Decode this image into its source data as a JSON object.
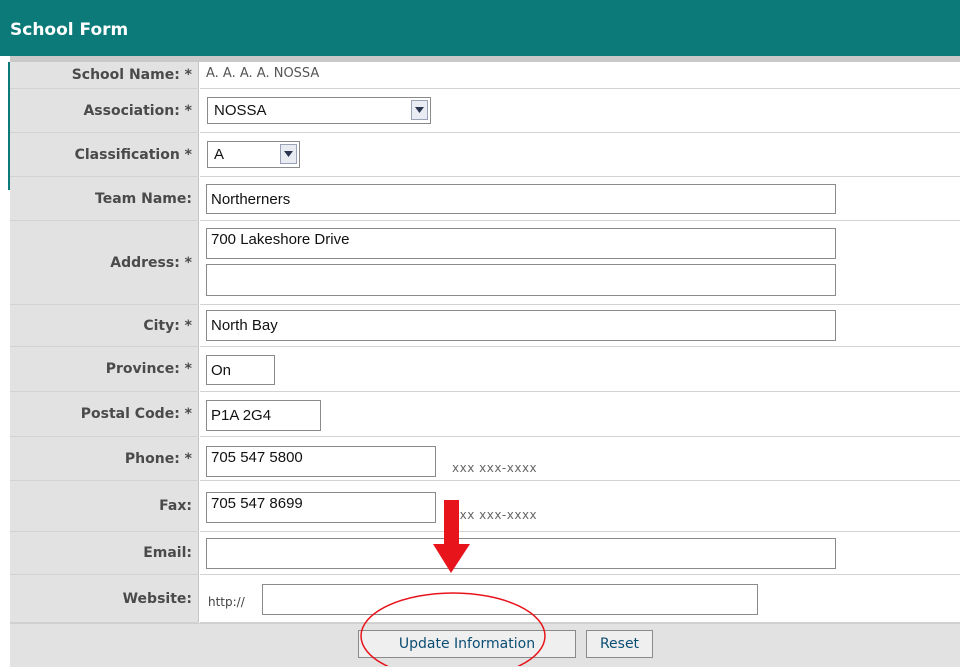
{
  "header": {
    "title": "School Form"
  },
  "fields": {
    "school_name": {
      "label": "School Name: *",
      "value": "A. A. A. A. NOSSA"
    },
    "association": {
      "label": "Association: *",
      "value": "NOSSA"
    },
    "classification": {
      "label": "Classification *",
      "value": "A"
    },
    "team_name": {
      "label": "Team Name:",
      "value": "Northerners"
    },
    "address": {
      "label": "Address: *",
      "line1": "700 Lakeshore Drive",
      "line2": ""
    },
    "city": {
      "label": "City: *",
      "value": "North Bay"
    },
    "province": {
      "label": "Province: *",
      "value": "On"
    },
    "postal_code": {
      "label": "Postal Code: *",
      "value": "P1A 2G4"
    },
    "phone": {
      "label": "Phone: *",
      "value": "705 547 5800",
      "hint": "xxx xxx-xxxx"
    },
    "fax": {
      "label": "Fax:",
      "value": "705 547 8699",
      "hint": "xxx xxx-xxxx"
    },
    "email": {
      "label": "Email:",
      "value": ""
    },
    "website": {
      "label": "Website:",
      "prefix": "http://",
      "value": ""
    }
  },
  "buttons": {
    "update": "Update Information",
    "reset": "Reset"
  },
  "colors": {
    "header_bg": "#0b7a78",
    "label_bg": "#e2e2e2",
    "annotation_red": "#e8141c"
  }
}
